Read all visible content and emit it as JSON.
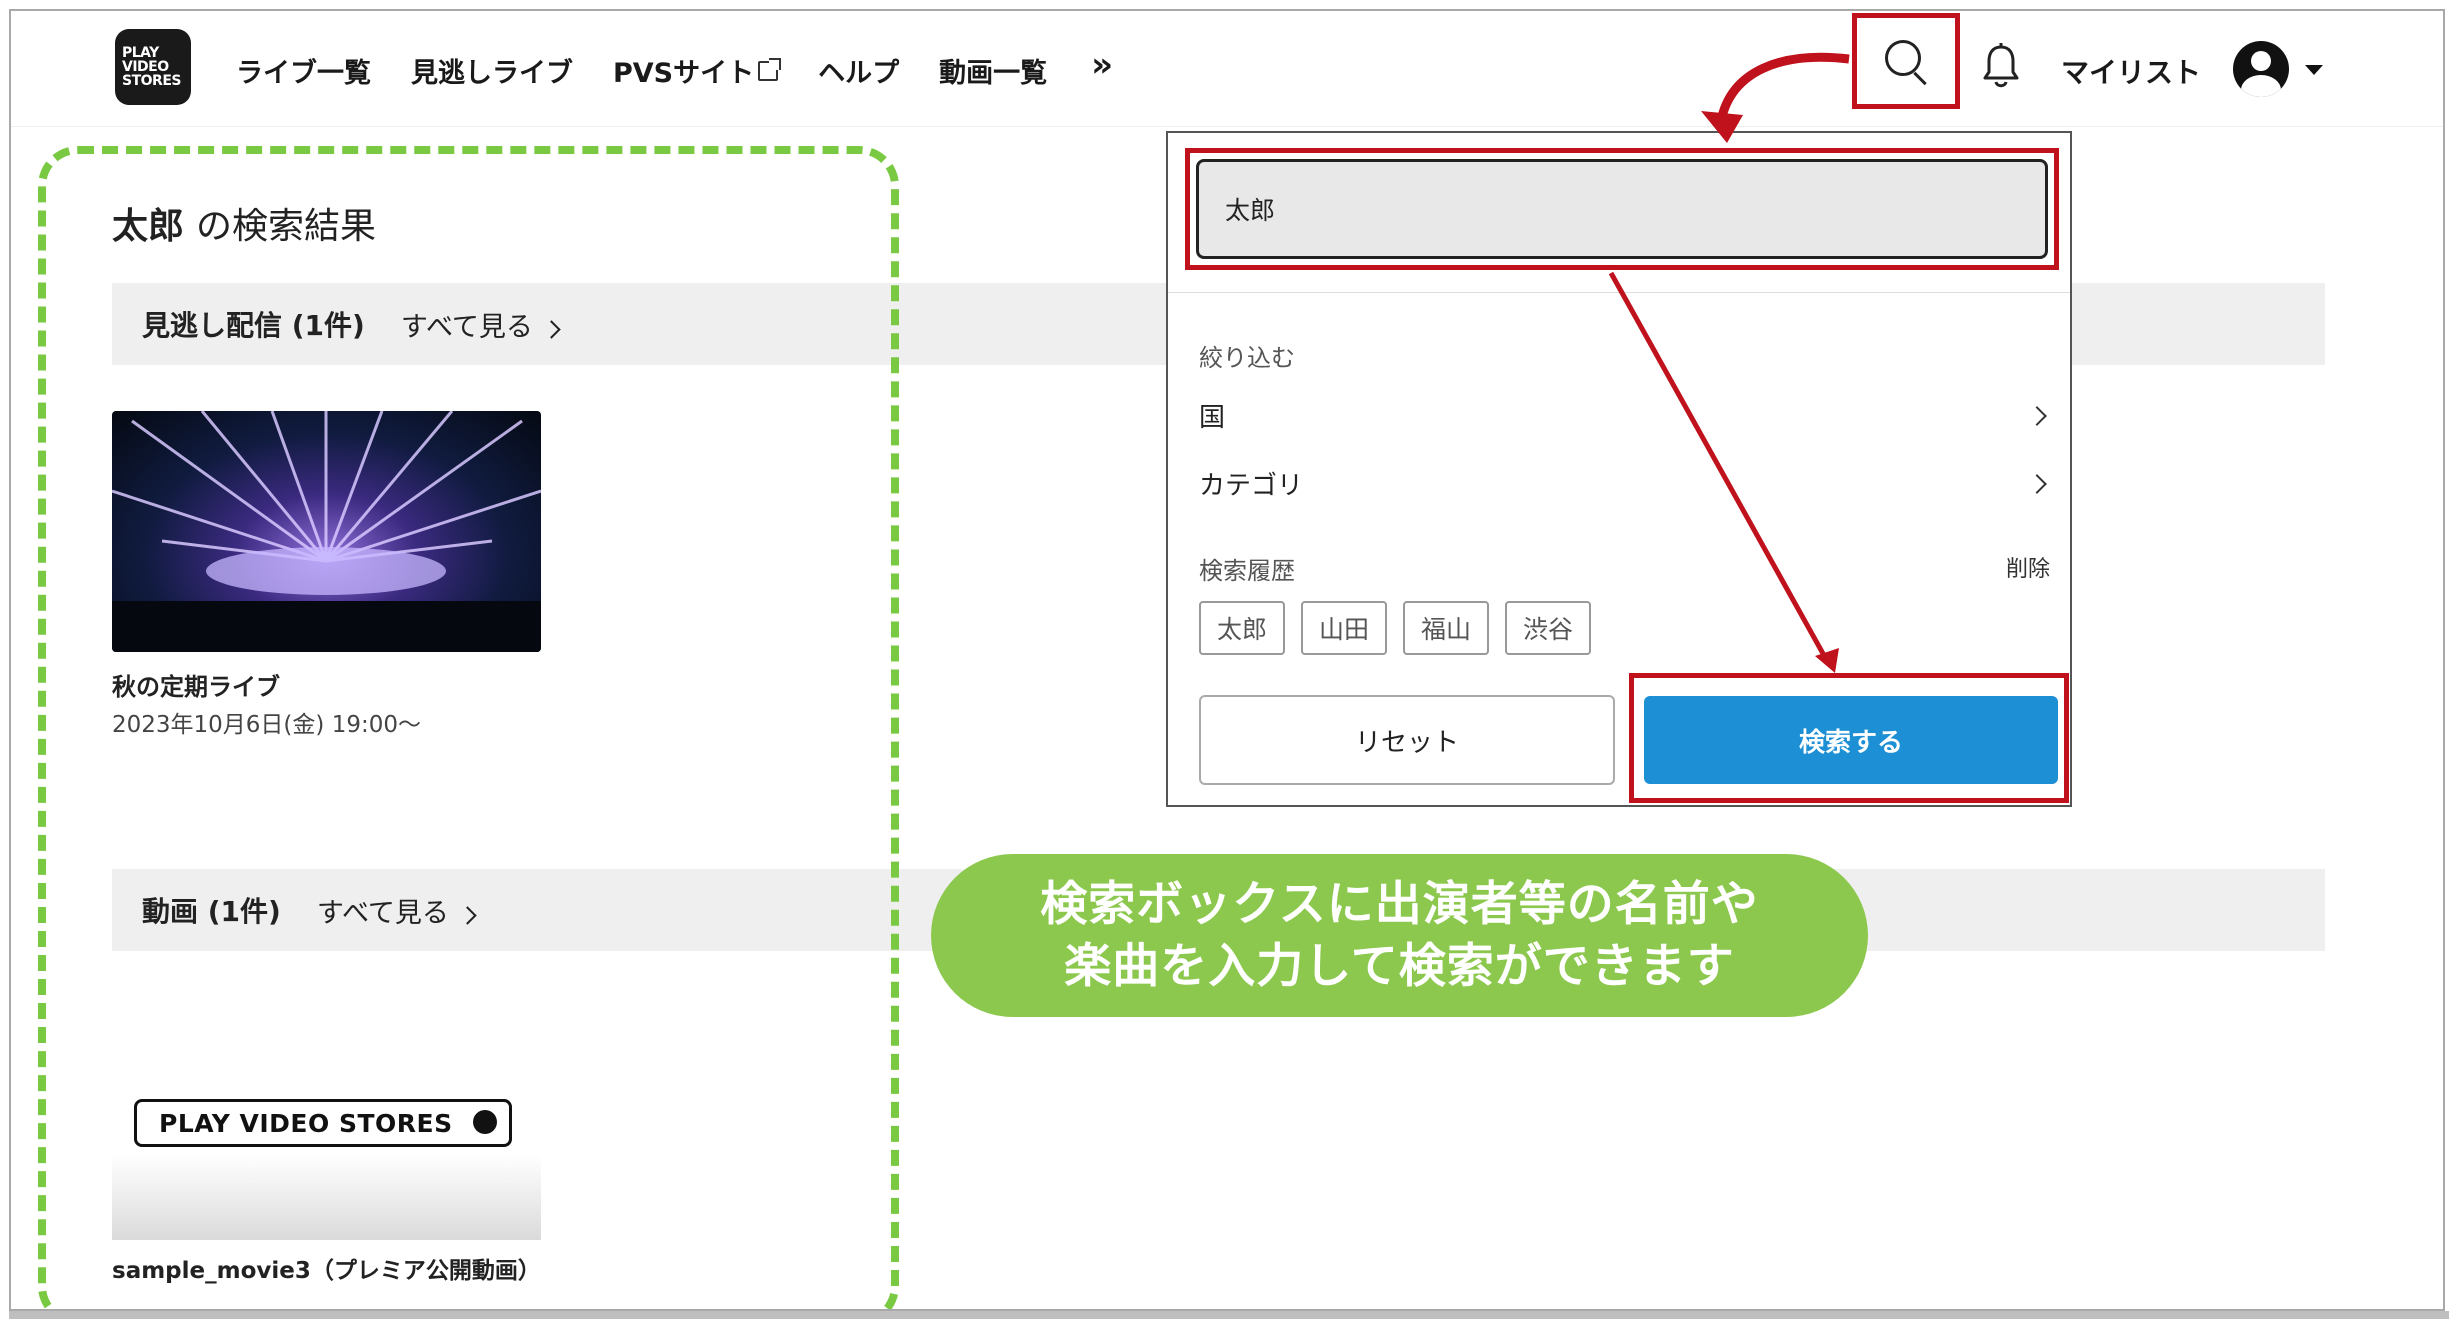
{
  "header": {
    "logo_lines": [
      "PLAY",
      "VIDEO",
      "STORES"
    ],
    "nav": [
      {
        "label": "ライブ一覧",
        "icon": ""
      },
      {
        "label": "見逃しライブ",
        "icon": ""
      },
      {
        "label": "PVSサイト",
        "icon": "external-link-icon"
      },
      {
        "label": "ヘルプ",
        "icon": ""
      },
      {
        "label": "動画一覧",
        "icon": ""
      }
    ],
    "nav_more": "»",
    "mylist": "マイリスト"
  },
  "main": {
    "result_query": "太郎",
    "result_suffix": "の検索結果",
    "section_missed": {
      "title": "見逃し配信 (1件)",
      "see_all": "すべて見る"
    },
    "card1": {
      "title": "秋の定期ライブ",
      "date": "2023年10月6日(金) 19:00〜"
    },
    "section_videos": {
      "title": "動画 (1件)",
      "see_all": "すべて見る"
    },
    "card2": {
      "badge": "PLAY VIDEO STORES",
      "title": "sample_movie3（プレミア公開動画）"
    }
  },
  "dropdown": {
    "input_value": "太郎",
    "filter_label": "絞り込む",
    "filters": [
      {
        "label": "国"
      },
      {
        "label": "カテゴリ"
      }
    ],
    "history_label": "検索履歴",
    "delete_label": "削除",
    "history": [
      "太郎",
      "山田",
      "福山",
      "渋谷"
    ],
    "reset_label": "リセット",
    "submit_label": "検索する"
  },
  "callout": {
    "line1": "検索ボックスに出演者等の名前や",
    "line2": "楽曲を入力して検索ができます"
  },
  "colors": {
    "accent_red": "#c0121c",
    "search_blue": "#1d8fd5",
    "green": "#8cc84e"
  }
}
